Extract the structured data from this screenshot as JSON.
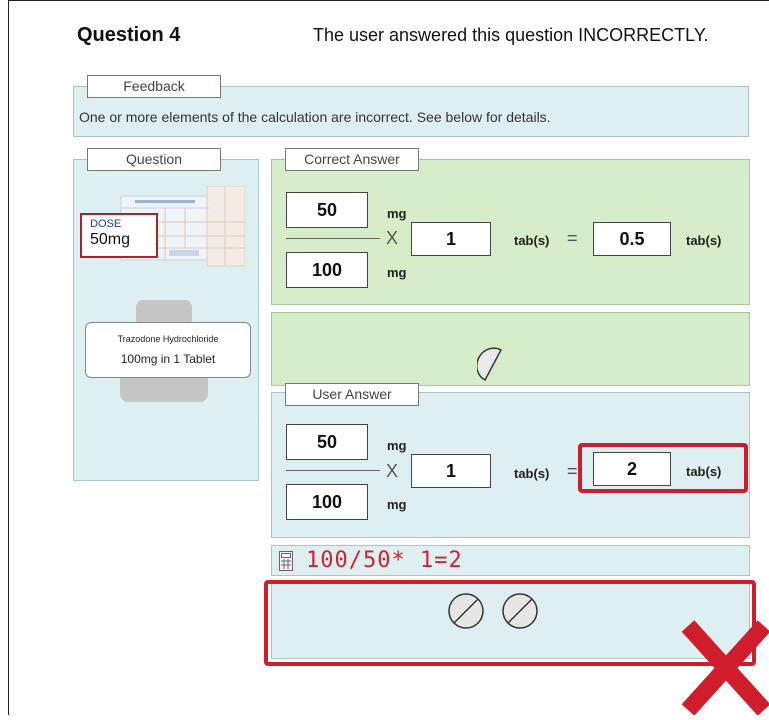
{
  "header": {
    "question": "Question 4",
    "status": "The user answered this question INCORRECTLY."
  },
  "feedback": {
    "tab": "Feedback",
    "message": "One or more elements of the calculation are incorrect. See below for details."
  },
  "question_panel": {
    "tab": "Question",
    "dose_label": "DOSE",
    "dose_value": "50mg",
    "label_line1": "Trazodone Hydrochloride",
    "label_line2": "100mg in 1 Tablet"
  },
  "correct": {
    "tab": "Correct Answer",
    "numerator": "50",
    "numerator_unit": "mg",
    "denominator": "100",
    "denominator_unit": "mg",
    "times": "X",
    "multiplier": "1",
    "multiplier_unit": "tab(s)",
    "equals": "=",
    "result": "0.5",
    "result_unit": "tab(s)"
  },
  "user": {
    "tab": "User Answer",
    "numerator": "50",
    "numerator_unit": "mg",
    "denominator": "100",
    "denominator_unit": "mg",
    "times": "X",
    "multiplier": "1",
    "multiplier_unit": "tab(s)",
    "equals": "=",
    "result": "2",
    "result_unit": "tab(s)"
  },
  "calculator": {
    "display": "100/50* 1=2"
  },
  "colors": {
    "wrong": "#d01d2b",
    "calc_text": "#d4222e"
  }
}
